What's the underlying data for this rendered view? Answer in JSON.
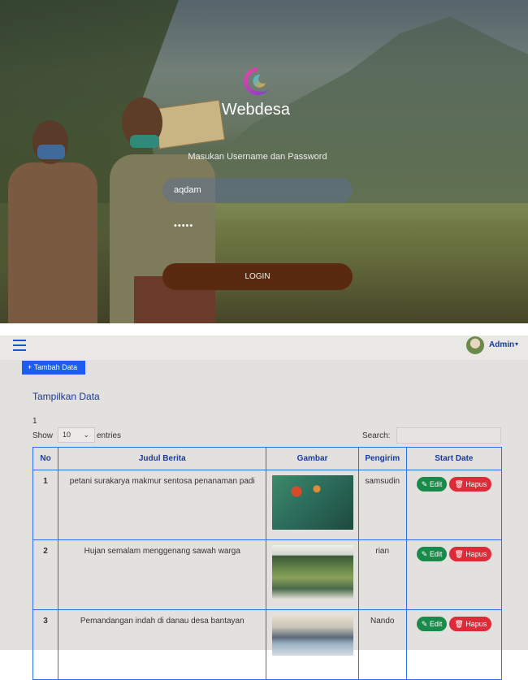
{
  "login": {
    "brand": "Webdesa",
    "prompt": "Masukan Username dan Password",
    "username_value": "aqdam",
    "password_value": "•••••",
    "login_button": "LOGIN"
  },
  "topbar": {
    "user_name": "Admin",
    "caret": "▾"
  },
  "toolbar": {
    "add_label": "+ Tambah Data"
  },
  "card": {
    "title": "Tampilkan Data",
    "page_number": "1",
    "show_label": "Show",
    "show_value": "10",
    "entries_label": "entries",
    "search_label": "Search:"
  },
  "table": {
    "headers": [
      "No",
      "Judul Berita",
      "Gambar",
      "Pengirim",
      "Start Date"
    ],
    "rows": [
      {
        "no": "1",
        "judul": "petani surakarya makmur sentosa penanaman padi",
        "pengirim": "samsudin"
      },
      {
        "no": "2",
        "judul": "Hujan semalam menggenang sawah warga",
        "pengirim": "rian"
      },
      {
        "no": "3",
        "judul": "Pemandangan indah di danau desa bantayan",
        "pengirim": "Nando"
      }
    ],
    "edit_label": "Edit",
    "delete_label": "Hapus"
  },
  "icons": {
    "menu": "hamburger-icon",
    "edit": "pencil-icon",
    "delete": "trash-icon",
    "select": "chevron-down-icon"
  },
  "colors": {
    "primary": "#1d5cf0",
    "success": "#1a8a4a",
    "danger": "#dd2c38",
    "login_button": "#5a2a10"
  }
}
